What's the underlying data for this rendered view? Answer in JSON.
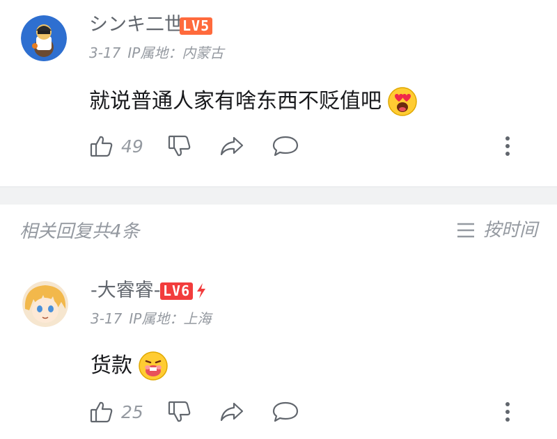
{
  "comment": {
    "username": "シンキ二世",
    "level": "LV5",
    "level_color": "#ff6a3c",
    "date": "3-17",
    "ip_location": "IP属地：内蒙古",
    "text": "就说普通人家有啥东西不贬值吧",
    "emoji": "heart-eyes-emoji",
    "likes": "49"
  },
  "replies_header": {
    "count_label": "相关回复共4条",
    "sort_label": "按时间"
  },
  "reply": {
    "username": "-大睿睿-",
    "level": "LV6",
    "level_color": "#f23c3c",
    "date": "3-17",
    "ip_location": "IP属地：上海",
    "text": "货款",
    "emoji": "eating-emoji",
    "likes": "25"
  },
  "icons": {
    "like": "thumbs-up-icon",
    "dislike": "thumbs-down-icon",
    "share": "share-arrow-icon",
    "reply": "chat-bubble-icon",
    "more": "vertical-dots-icon",
    "sort": "sort-lines-icon"
  }
}
